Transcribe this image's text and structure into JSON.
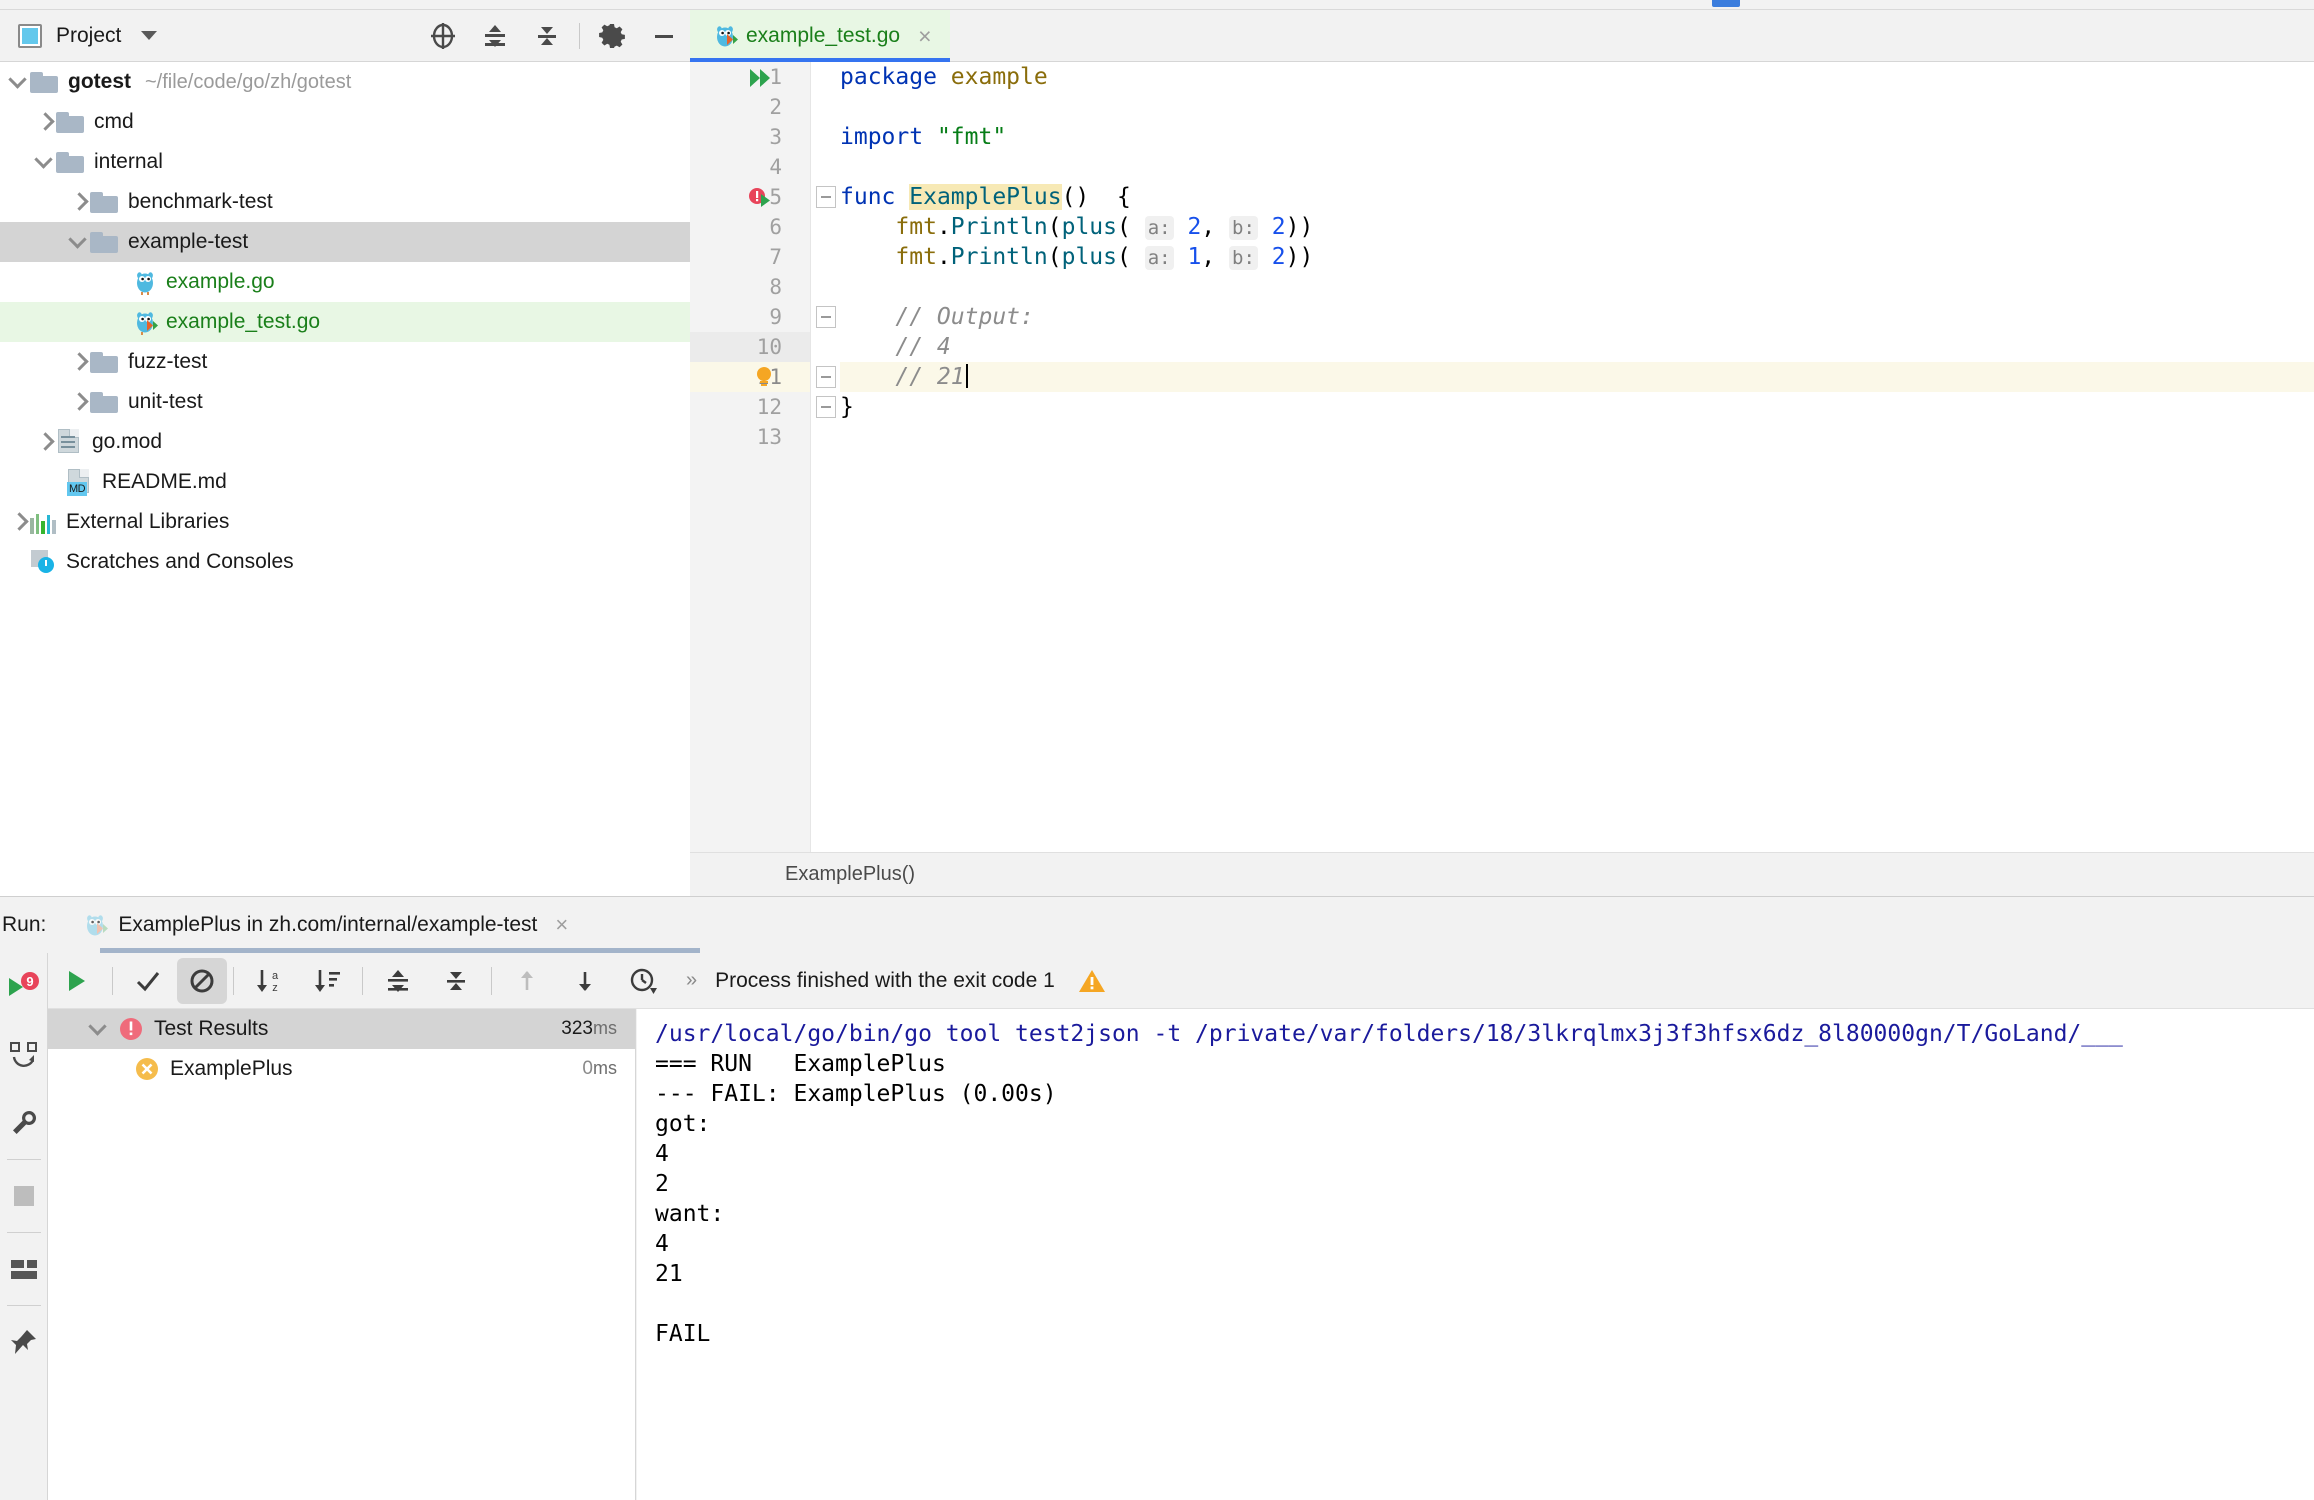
{
  "project_panel": {
    "title": "Project",
    "icons": [
      "project-window-icon",
      "chevron-down-icon",
      "locate-icon",
      "expand-all-icon",
      "collapse-all-icon",
      "gear-icon",
      "minimize-icon"
    ],
    "tree": [
      {
        "label": "gotest",
        "path": "~/file/code/go/zh/gotest",
        "icon": "folder-icon",
        "state": "expanded",
        "indent": 0,
        "bold": true
      },
      {
        "label": "cmd",
        "icon": "folder-icon",
        "state": "collapsed",
        "indent": 1
      },
      {
        "label": "internal",
        "icon": "folder-icon",
        "state": "expanded",
        "indent": 1
      },
      {
        "label": "benchmark-test",
        "icon": "folder-icon",
        "state": "collapsed",
        "indent": 2
      },
      {
        "label": "example-test",
        "icon": "folder-icon",
        "state": "expanded",
        "indent": 2,
        "selected": true
      },
      {
        "label": "example.go",
        "icon": "go-file-icon",
        "indent": 3,
        "go": true
      },
      {
        "label": "example_test.go",
        "icon": "go-test-file-icon",
        "indent": 3,
        "go": true,
        "highlighted": true
      },
      {
        "label": "fuzz-test",
        "icon": "folder-icon",
        "state": "collapsed",
        "indent": 2
      },
      {
        "label": "unit-test",
        "icon": "folder-icon",
        "state": "collapsed",
        "indent": 2
      },
      {
        "label": "go.mod",
        "icon": "go-mod-file-icon",
        "state": "collapsed",
        "indent": 1
      },
      {
        "label": "README.md",
        "icon": "markdown-file-icon",
        "indent": 1
      },
      {
        "label": "External Libraries",
        "icon": "libraries-icon",
        "state": "collapsed",
        "indent": 0
      },
      {
        "label": "Scratches and Consoles",
        "icon": "scratches-icon",
        "indent": 0
      }
    ]
  },
  "editor": {
    "tab": {
      "label": "example_test.go",
      "icon": "go-test-file-icon",
      "close": "×"
    },
    "breadcrumb": "ExamplePlus()",
    "line_numbers": [
      "1",
      "2",
      "3",
      "4",
      "5",
      "6",
      "7",
      "8",
      "9",
      "10",
      "11",
      "12",
      "13"
    ],
    "code_lines": [
      {
        "n": 1,
        "tokens": [
          {
            "t": "package ",
            "c": "kw"
          },
          {
            "t": "example",
            "c": "pkg"
          }
        ]
      },
      {
        "n": 2,
        "tokens": []
      },
      {
        "n": 3,
        "tokens": [
          {
            "t": "import ",
            "c": "kw"
          },
          {
            "t": "\"fmt\"",
            "c": "str"
          }
        ]
      },
      {
        "n": 4,
        "tokens": []
      },
      {
        "n": 5,
        "tokens": [
          {
            "t": "func ",
            "c": "kw"
          },
          {
            "t": "ExamplePlus",
            "c": "fn hl-ident"
          },
          {
            "t": "()  {",
            "c": "plain"
          }
        ]
      },
      {
        "n": 6,
        "tokens": [
          {
            "t": "    ",
            "c": "plain"
          },
          {
            "t": "fmt",
            "c": "pkg"
          },
          {
            "t": ".",
            "c": "plain"
          },
          {
            "t": "Println",
            "c": "fn"
          },
          {
            "t": "(",
            "c": "plain"
          },
          {
            "t": "plus",
            "c": "fn"
          },
          {
            "t": "( ",
            "c": "plain"
          },
          {
            "t": "a:",
            "c": "hint"
          },
          {
            "t": " ",
            "c": "plain"
          },
          {
            "t": "2",
            "c": "num"
          },
          {
            "t": ", ",
            "c": "plain"
          },
          {
            "t": "b:",
            "c": "hint"
          },
          {
            "t": " ",
            "c": "plain"
          },
          {
            "t": "2",
            "c": "num"
          },
          {
            "t": "))",
            "c": "plain"
          }
        ]
      },
      {
        "n": 7,
        "tokens": [
          {
            "t": "    ",
            "c": "plain"
          },
          {
            "t": "fmt",
            "c": "pkg"
          },
          {
            "t": ".",
            "c": "plain"
          },
          {
            "t": "Println",
            "c": "fn"
          },
          {
            "t": "(",
            "c": "plain"
          },
          {
            "t": "plus",
            "c": "fn"
          },
          {
            "t": "( ",
            "c": "plain"
          },
          {
            "t": "a:",
            "c": "hint"
          },
          {
            "t": " ",
            "c": "plain"
          },
          {
            "t": "1",
            "c": "num"
          },
          {
            "t": ", ",
            "c": "plain"
          },
          {
            "t": "b:",
            "c": "hint"
          },
          {
            "t": " ",
            "c": "plain"
          },
          {
            "t": "2",
            "c": "num"
          },
          {
            "t": "))",
            "c": "plain"
          }
        ]
      },
      {
        "n": 8,
        "tokens": []
      },
      {
        "n": 9,
        "tokens": [
          {
            "t": "    // Output:",
            "c": "cmt"
          }
        ]
      },
      {
        "n": 10,
        "tokens": [
          {
            "t": "    // 4",
            "c": "cmt"
          }
        ]
      },
      {
        "n": 11,
        "tokens": [
          {
            "t": "    // 21",
            "c": "cmt"
          }
        ],
        "caret": true
      },
      {
        "n": 12,
        "tokens": [
          {
            "t": "}",
            "c": "plain"
          }
        ]
      },
      {
        "n": 13,
        "tokens": []
      }
    ],
    "gutter_markers": {
      "line1": "run-all-icon",
      "line5": "test-failed-run-icon",
      "line11": "intention-bulb-icon"
    }
  },
  "run_panel": {
    "run_label": "Run:",
    "tab": {
      "label": "ExamplePlus in zh.com/internal/example-test",
      "icon": "go-test-file-icon",
      "close": "×"
    },
    "side_buttons": [
      "rerun-with-badge-icon",
      "rerun-failed-icon",
      "settings-wrench-icon",
      "stop-icon",
      "layout-icon",
      "pin-icon"
    ],
    "side_badge": "9",
    "toolbar_buttons": [
      "run-icon",
      "show-passed-icon",
      "hide-ignored-icon",
      "sort-alphabetically-icon",
      "sort-by-duration-icon",
      "expand-all-icon",
      "collapse-all-icon",
      "previous-failed-icon",
      "next-failed-icon",
      "history-icon"
    ],
    "status": "Process finished with the exit code 1",
    "status_icon": "warning-icon",
    "status_chevron": "»",
    "results": [
      {
        "label": "Test Results",
        "time": "323",
        "unit": "ms",
        "icon": "error-icon",
        "state": "expanded",
        "indent": 0,
        "selected": true
      },
      {
        "label": "ExamplePlus",
        "time": "0",
        "unit": "ms",
        "icon": "failed-test-icon",
        "indent": 1
      }
    ],
    "console": [
      {
        "text": "/usr/local/go/bin/go tool test2json -t /private/var/folders/18/3lkrqlmx3j3f3hfsx6dz_8l80000gn/T/GoLand/___",
        "link": true
      },
      {
        "text": "=== RUN   ExamplePlus"
      },
      {
        "text": "--- FAIL: ExamplePlus (0.00s)"
      },
      {
        "text": "got:"
      },
      {
        "text": "4"
      },
      {
        "text": "2"
      },
      {
        "text": "want:"
      },
      {
        "text": "4"
      },
      {
        "text": "21"
      },
      {
        "text": ""
      },
      {
        "text": "FAIL"
      }
    ]
  },
  "colors": {
    "accent_blue": "#3574f0",
    "go_green": "#1a7f1a",
    "selection_gray": "#d4d4d4",
    "highlight_green": "#e8f7e4",
    "caret_line": "#fbf8e8"
  }
}
